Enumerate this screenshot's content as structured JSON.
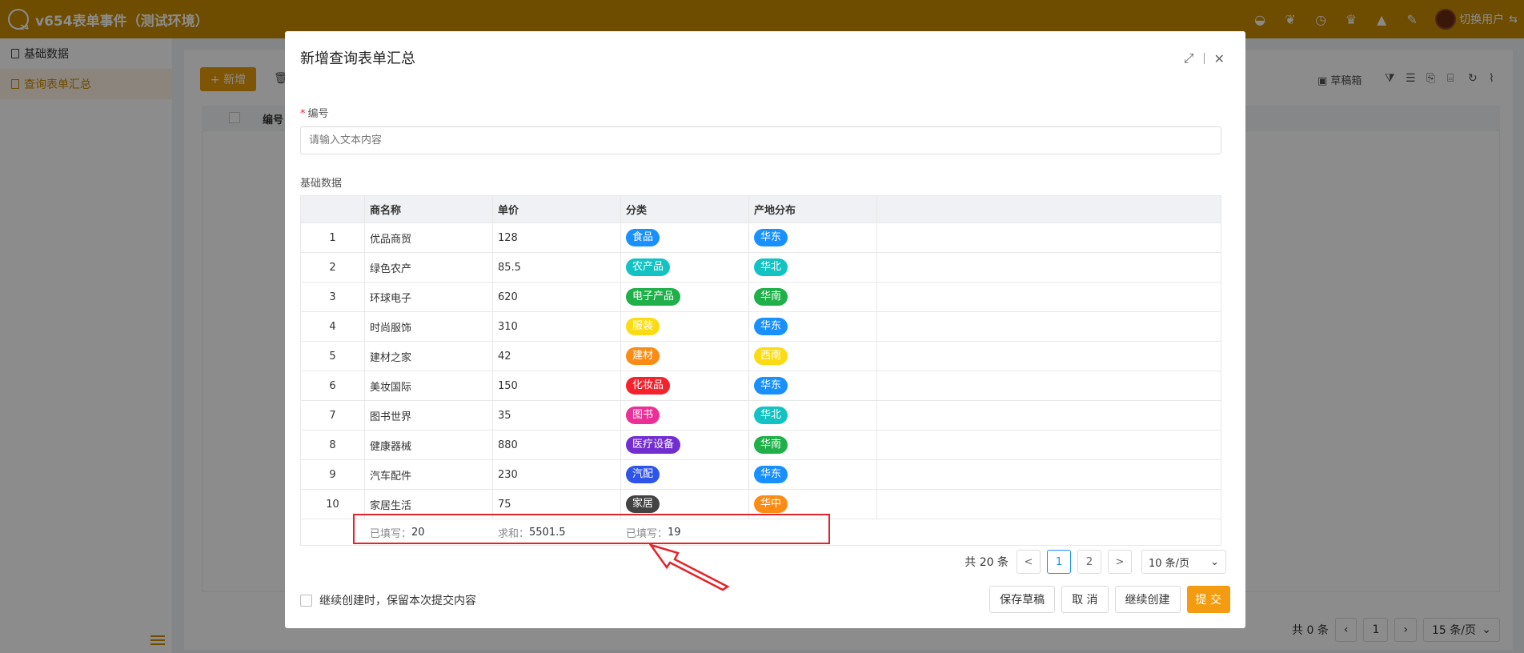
{
  "app": {
    "title": "v654表单事件（测试环境）",
    "user_label": "切换用户",
    "switch_symbol": "⇆"
  },
  "sidebar": {
    "items": [
      {
        "label": "基础数据",
        "active": false
      },
      {
        "label": "查询表单汇总",
        "active": true
      }
    ]
  },
  "background": {
    "add_label": "+ 新增",
    "delete_icon_label": "删",
    "column_header": "编号",
    "draft_label": "草稿箱",
    "total_label": "共 0 条",
    "page": "1",
    "page_size": "15 条/页"
  },
  "modal": {
    "title": "新增查询表单汇总",
    "field_label": "编号",
    "field_placeholder": "请输入文本内容",
    "section_label": "基础数据",
    "columns": [
      "",
      "商名称",
      "单价",
      "分类",
      "产地分布"
    ],
    "rows": [
      {
        "index": "1",
        "name": "优品商贸",
        "price": "128",
        "category": "食品",
        "category_color": "#1890ff",
        "region": "华东",
        "region_color": "#1890ff"
      },
      {
        "index": "2",
        "name": "绿色农产",
        "price": "85.5",
        "category": "农产品",
        "category_color": "#13c2c2",
        "region": "华北",
        "region_color": "#13c2c2"
      },
      {
        "index": "3",
        "name": "环球电子",
        "price": "620",
        "category": "电子产品",
        "category_color": "#20b049",
        "region": "华南",
        "region_color": "#20b049"
      },
      {
        "index": "4",
        "name": "时尚服饰",
        "price": "310",
        "category": "服装",
        "category_color": "#fadb14",
        "region": "华东",
        "region_color": "#1890ff"
      },
      {
        "index": "5",
        "name": "建材之家",
        "price": "42",
        "category": "建材",
        "category_color": "#fa8c16",
        "region": "西南",
        "region_color": "#fadb14"
      },
      {
        "index": "6",
        "name": "美妆国际",
        "price": "150",
        "category": "化妆品",
        "category_color": "#f5222d",
        "region": "华东",
        "region_color": "#1890ff"
      },
      {
        "index": "7",
        "name": "图书世界",
        "price": "35",
        "category": "图书",
        "category_color": "#eb2f96",
        "region": "华北",
        "region_color": "#13c2c2"
      },
      {
        "index": "8",
        "name": "健康器械",
        "price": "880",
        "category": "医疗设备",
        "category_color": "#722ed1",
        "region": "华南",
        "region_color": "#20b049"
      },
      {
        "index": "9",
        "name": "汽车配件",
        "price": "230",
        "category": "汽配",
        "category_color": "#2f54eb",
        "region": "华东",
        "region_color": "#1890ff"
      },
      {
        "index": "10",
        "name": "家居生活",
        "price": "75",
        "category": "家居",
        "category_color": "#434343",
        "region": "华中",
        "region_color": "#fa8c16"
      }
    ],
    "summary": {
      "name_label": "已填写：",
      "name_value": "20",
      "price_label": "求和：",
      "price_value": "5501.5",
      "category_label": "已填写：",
      "category_value": "19"
    },
    "pagination": {
      "total": "共 20 条",
      "prev": "<",
      "pages": [
        "1",
        "2"
      ],
      "next": ">",
      "page_size": "10 条/页"
    },
    "footer": {
      "keep_label": "继续创建时，保留本次提交内容",
      "save_draft": "保存草稿",
      "cancel": "取 消",
      "continue_create": "继续创建",
      "submit": "提 交"
    }
  },
  "colors": {
    "topbar": "#c98a00",
    "accent": "#e69a0a",
    "annotation": "#e5232b"
  }
}
